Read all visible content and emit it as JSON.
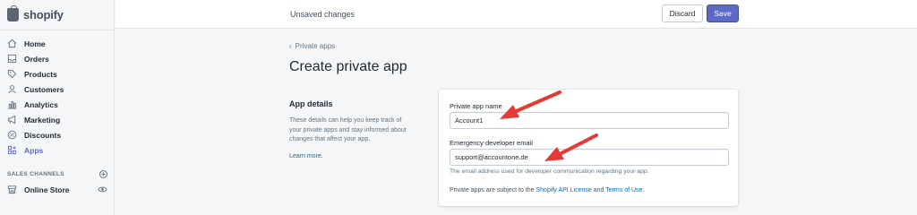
{
  "app": {
    "logo_text": "shopify"
  },
  "sidebar": {
    "items": [
      {
        "label": "Home",
        "icon": "home-icon"
      },
      {
        "label": "Orders",
        "icon": "orders-icon"
      },
      {
        "label": "Products",
        "icon": "tag-icon"
      },
      {
        "label": "Customers",
        "icon": "person-icon"
      },
      {
        "label": "Analytics",
        "icon": "bar-chart-icon"
      },
      {
        "label": "Marketing",
        "icon": "megaphone-icon"
      },
      {
        "label": "Discounts",
        "icon": "discount-icon"
      },
      {
        "label": "Apps",
        "icon": "apps-icon",
        "active": true
      }
    ],
    "sales_channels_label": "SALES CHANNELS",
    "online_store_label": "Online Store"
  },
  "topbar": {
    "status": "Unsaved changes",
    "discard_label": "Discard",
    "save_label": "Save"
  },
  "page": {
    "breadcrumb": "Private apps",
    "title": "Create private app"
  },
  "details": {
    "title": "App details",
    "description": "These details can help you keep track of your private apps and stay informed about changes that affect your app.",
    "learn_more": "Learn more."
  },
  "form": {
    "app_name_label": "Private app name",
    "app_name_value": "Account1",
    "email_label": "Emergency developer email",
    "email_value": "support@accountone.de",
    "email_help": "The email address used for developer communication regarding your app.",
    "terms_prefix": "Private apps are subject to the ",
    "terms_link": "Shopify API License and Terms of Use",
    "terms_suffix": "."
  },
  "colors": {
    "accent": "#5c6ac4",
    "link": "#006fbb",
    "annotation": "#e53935"
  }
}
